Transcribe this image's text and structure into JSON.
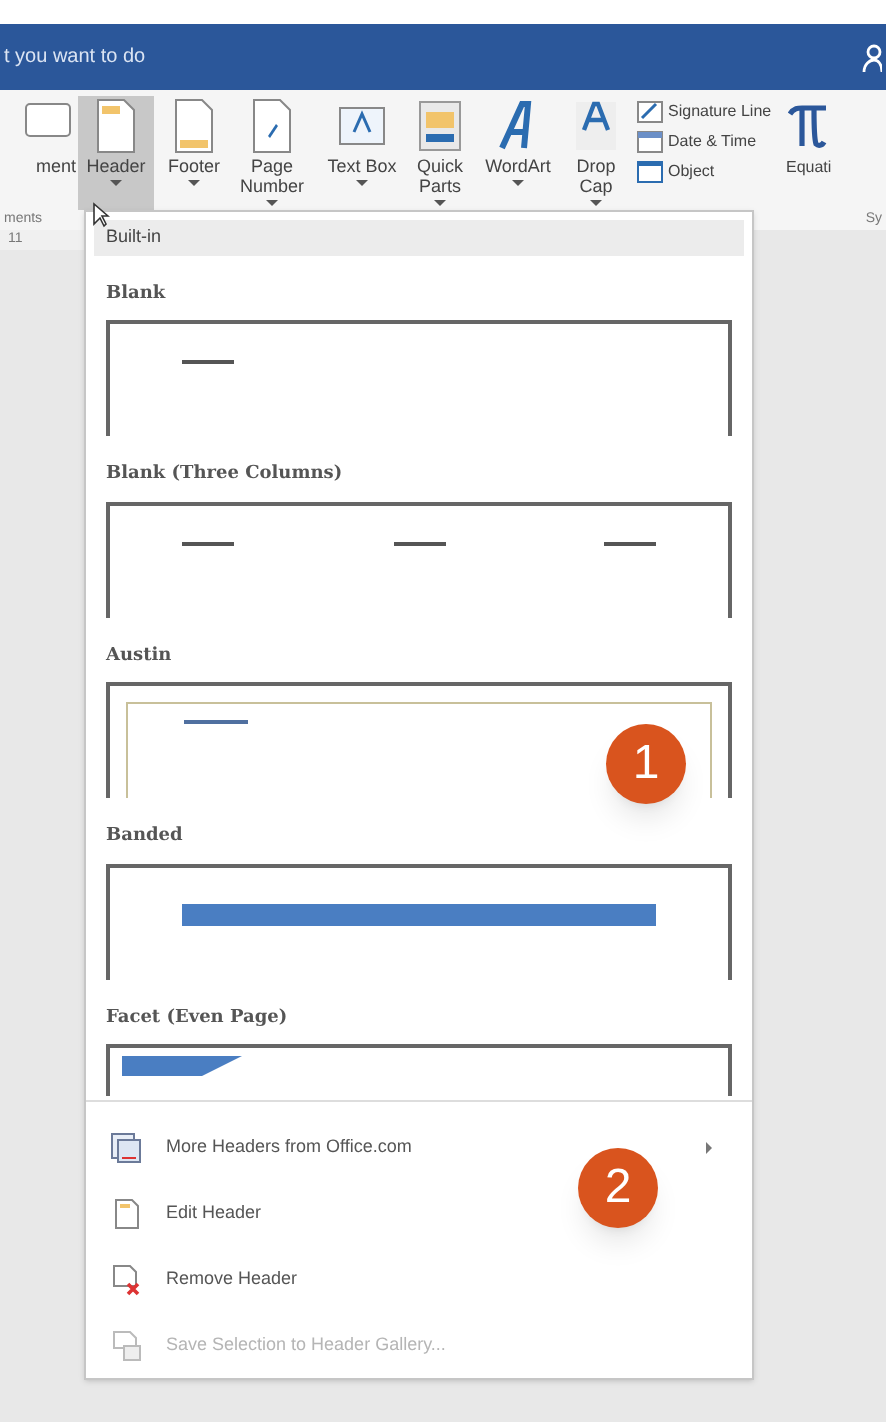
{
  "title_bar": {
    "search_text": "t you want to do"
  },
  "ribbon": {
    "buttons": [
      {
        "kind": "comment",
        "label": "ment",
        "caret": false,
        "selected": false
      },
      {
        "kind": "header",
        "label": "Header",
        "caret": true,
        "selected": true
      },
      {
        "kind": "footer",
        "label": "Footer",
        "caret": true,
        "selected": false
      },
      {
        "kind": "pagenum",
        "label": "Page Number",
        "caret": true,
        "selected": false
      },
      {
        "kind": "textbox",
        "label": "Text Box",
        "caret": true,
        "selected": false
      },
      {
        "kind": "quickparts",
        "label": "Quick Parts",
        "caret": true,
        "selected": false
      },
      {
        "kind": "wordart",
        "label": "WordArt",
        "caret": true,
        "selected": false
      },
      {
        "kind": "dropcap",
        "label": "Drop Cap",
        "caret": true,
        "selected": false
      }
    ],
    "small_buttons": [
      {
        "kind": "signature",
        "label": "Signature Line"
      },
      {
        "kind": "datetime",
        "label": "Date & Time"
      },
      {
        "kind": "object",
        "label": "Object"
      }
    ],
    "equation_label": "Equati",
    "group_labels": [
      "ments",
      "Sy"
    ],
    "font_size": "11"
  },
  "gallery": {
    "section": "Built-in",
    "items": [
      {
        "kind": "blank",
        "name": "Blank"
      },
      {
        "kind": "three",
        "name": "Blank (Three Columns)"
      },
      {
        "kind": "austin",
        "name": "Austin"
      },
      {
        "kind": "banded",
        "name": "Banded"
      },
      {
        "kind": "facet",
        "name": "Facet (Even Page)"
      }
    ]
  },
  "menu": [
    {
      "kind": "more",
      "label": "More Headers from Office.com",
      "submenu": true,
      "disabled": false
    },
    {
      "kind": "edit",
      "label": "Edit Header",
      "submenu": false,
      "disabled": false
    },
    {
      "kind": "remove",
      "label": "Remove Header",
      "submenu": false,
      "disabled": false
    },
    {
      "kind": "save",
      "label": "Save Selection to Header Gallery...",
      "submenu": false,
      "disabled": true
    }
  ],
  "callouts": [
    {
      "label": "1"
    },
    {
      "label": "2"
    }
  ]
}
